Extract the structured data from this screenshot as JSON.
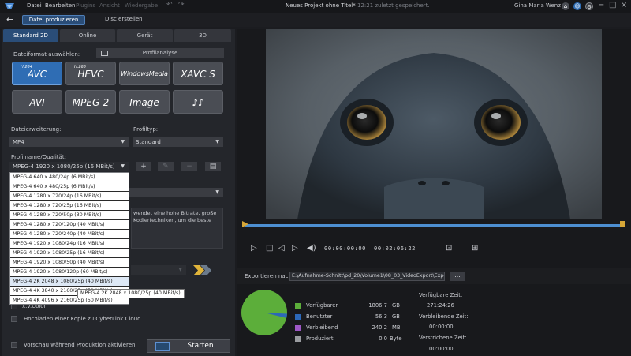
{
  "titlebar": {
    "menu": [
      "Datei",
      "Bearbeiten",
      "Plugins",
      "Ansicht",
      "Wiedergabe"
    ],
    "project_title": "Neues Projekt ohne Titel*",
    "saved_note": "12:21 zuletzt gespeichert.",
    "user_name": "Gina Maria Wenz"
  },
  "nav": {
    "produce_button": "Datei produzieren",
    "disc_button": "Disc erstellen"
  },
  "tabs": [
    "Standard 2D",
    "Online",
    "Gerät",
    "3D"
  ],
  "format": {
    "label": "Dateiformat auswählen:",
    "profile_analysis": "Profilanalyse",
    "buttons": [
      {
        "label": "AVC",
        "sup": "H.264"
      },
      {
        "label": "HEVC",
        "sup": "H.265"
      },
      {
        "label": "WindowsMedia",
        "sup": ""
      },
      {
        "label": "XAVC S",
        "sup": ""
      },
      {
        "label": "AVI",
        "sup": ""
      },
      {
        "label": "MPEG-2",
        "sup": ""
      },
      {
        "label": "Image",
        "sup": ""
      },
      {
        "label": "♪♪",
        "sup": ""
      }
    ]
  },
  "settings": {
    "extension_label": "Dateierweiterung:",
    "extension_value": "MP4",
    "profile_type_label": "Profiltyp:",
    "profile_type_value": "Standard",
    "quality_label": "Profilname/Qualität:",
    "quality_value": "MPEG-4 1920 x 1080/25p (16 MBit/s)",
    "description_text": "wendet eine hohe Bitrate, große Kodiertechniken, um die beste",
    "xvcolor": "x.v.Color",
    "upload_label": "Hochladen einer Kopie zu CyberLink Cloud",
    "preview_label": "Vorschau während Produktion aktivieren",
    "start_button": "Starten"
  },
  "quality_options": [
    "MPEG-4 640 x 480/24p (6 MBit/s)",
    "MPEG-4 640 x 480/25p (6 MBit/s)",
    "MPEG-4 1280 x 720/24p (16 MBit/s)",
    "MPEG-4 1280 x 720/25p (16 MBit/s)",
    "MPEG-4 1280 x 720/50p (30 MBit/s)",
    "MPEG-4 1280 x 720/120p (40 MBit/s)",
    "MPEG-4 1280 x 720/240p (40 MBit/s)",
    "MPEG-4 1920 x 1080/24p (16 MBit/s)",
    "MPEG-4 1920 x 1080/25p (16 MBit/s)",
    "MPEG-4 1920 x 1080/50p (40 MBit/s)",
    "MPEG-4 1920 x 1080/120p (60 MBit/s)",
    "MPEG-4 2K 2048 x 1080/25p (40 MBit/s)",
    "MPEG-4 4K 3840 x 2160/25p (50 MBit/s)",
    "MPEG-4 4K 4096 x 2160/25p (50 MBit/s)"
  ],
  "tooltip": "MPEG-4 2K 2048 x 1080/25p (40 MBit/s)",
  "player": {
    "current_time": "00:00:00:00",
    "total_time": "00:02:06:22"
  },
  "export": {
    "label": "Exportieren nach:",
    "path": "E:\\Aufnahme-Schnitt\\pd_20\\Volume1\\08_03_VideoExport\\Expo",
    "more": "..."
  },
  "disk": {
    "items": [
      {
        "label": "Verfügbarer",
        "value": "1806.7",
        "unit": "GB",
        "color": "#5cae3a"
      },
      {
        "label": "Benutzter",
        "value": "56.3",
        "unit": "GB",
        "color": "#2c68b8"
      },
      {
        "label": "Verbleibend",
        "value": "240.2",
        "unit": "MB",
        "color": "#9e58c6"
      },
      {
        "label": "Produziert",
        "value": "0.0",
        "unit": "Byte",
        "color": "#9a9ca0"
      }
    ],
    "used_fraction": 0.03
  },
  "times": {
    "available_label": "Verfügbare Zeit:",
    "available_value": "271:24:26",
    "remaining_label": "Verbleibende Zeit:",
    "remaining_value": "00:00:00",
    "elapsed_label": "Verstrichene Zeit:",
    "elapsed_value": "00:00:00"
  }
}
